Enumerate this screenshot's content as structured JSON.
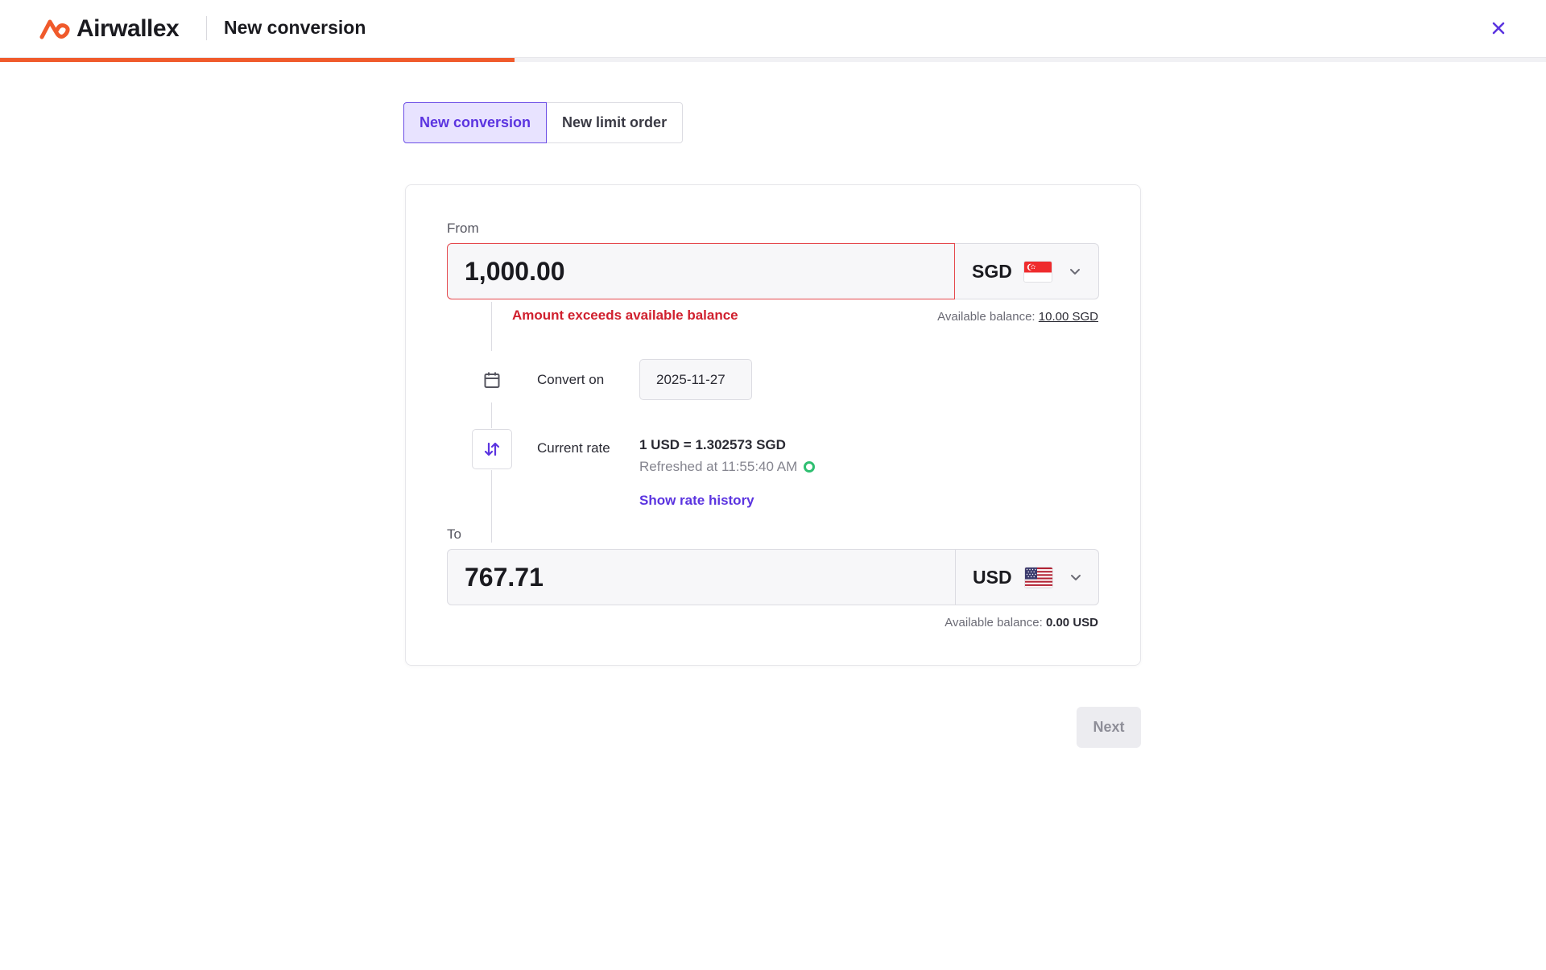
{
  "header": {
    "brand": "Airwallex",
    "title": "New conversion",
    "progress_fraction": 0.333
  },
  "tabs": [
    {
      "label": "New conversion",
      "active": true
    },
    {
      "label": "New limit order",
      "active": false
    }
  ],
  "from": {
    "label": "From",
    "amount": "1,000.00",
    "currency": "SGD",
    "flag_icon": "singapore-flag-icon",
    "error": "Amount exceeds available balance",
    "balance_label": "Available balance:",
    "balance_value": "10.00 SGD"
  },
  "convert_on": {
    "label": "Convert on",
    "date": "2025-11-27"
  },
  "rate": {
    "label": "Current rate",
    "value": "1 USD = 1.302573 SGD",
    "refreshed": "Refreshed at 11:55:40 AM",
    "history_link": "Show rate history"
  },
  "to": {
    "label": "To",
    "amount": "767.71",
    "currency": "USD",
    "flag_icon": "united-states-flag-icon",
    "balance_label": "Available balance:",
    "balance_value": "0.00 USD"
  },
  "footer": {
    "next_label": "Next"
  },
  "colors": {
    "brand_orange": "#f05a2b",
    "accent_purple": "#5b34e0",
    "error_red": "#d0202e",
    "success_green": "#2fbf71"
  }
}
